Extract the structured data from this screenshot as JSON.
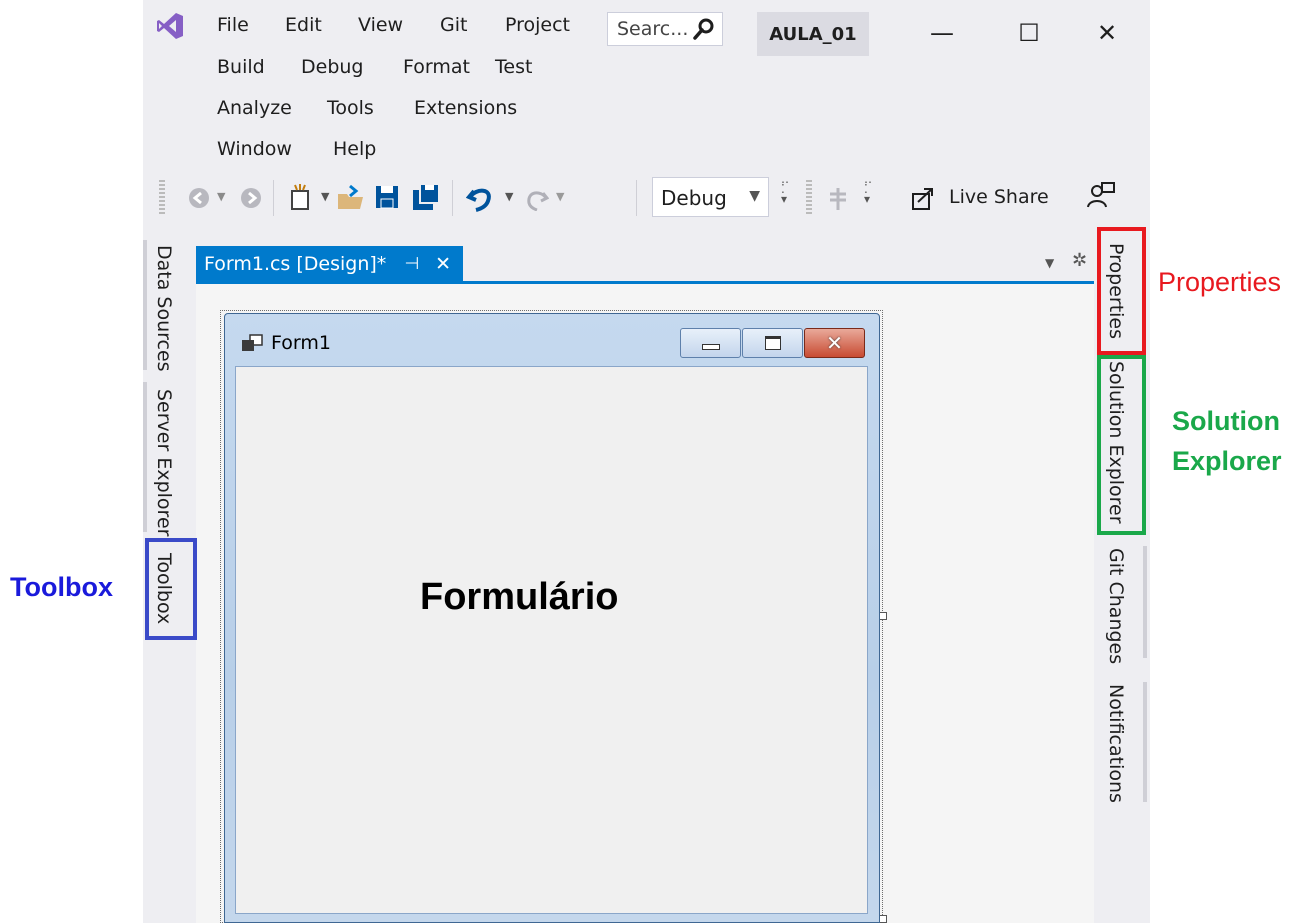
{
  "menu": {
    "row1": [
      "File",
      "Edit",
      "View",
      "Git",
      "Project"
    ],
    "row2": [
      "Build",
      "Debug",
      "Format",
      "Test"
    ],
    "row3": [
      "Analyze",
      "Tools",
      "Extensions"
    ],
    "row4": [
      "Window",
      "Help"
    ]
  },
  "search": {
    "placeholder": "Searc..."
  },
  "title": {
    "project_name": "AULA_01"
  },
  "window_controls": {
    "minimize": "—",
    "maximize": "☐",
    "close": "✕"
  },
  "toolbar": {
    "configuration": "Debug",
    "live_share": "Live Share",
    "icons": [
      "back-icon",
      "forward-icon",
      "new-project-icon",
      "open-file-icon",
      "save-icon",
      "save-all-icon",
      "undo-icon",
      "redo-icon",
      "breakpoint-icon",
      "feedback-icon"
    ]
  },
  "left_panel_tabs": [
    "Data Sources",
    "Server Explorer",
    "Toolbox"
  ],
  "right_panel_tabs": [
    "Properties",
    "Solution Explorer",
    "Git Changes",
    "Notifications"
  ],
  "editor": {
    "tab_label": "Form1.cs [Design]*",
    "pin": "⊣",
    "close": "✕"
  },
  "form": {
    "title": "Form1",
    "caption_buttons": [
      "minimize",
      "maximize",
      "close"
    ]
  },
  "annotations": {
    "properties": "Properties",
    "solution_explorer_line1": "Solution",
    "solution_explorer_line2": "Explorer",
    "toolbox": "Toolbox",
    "form_label": "Formulário"
  },
  "colors": {
    "accent": "#007acc",
    "annotation_red": "#e8191f",
    "annotation_green": "#1aa84a",
    "annotation_blue": "#1a1adb",
    "vs_logo": "#865fc5"
  }
}
